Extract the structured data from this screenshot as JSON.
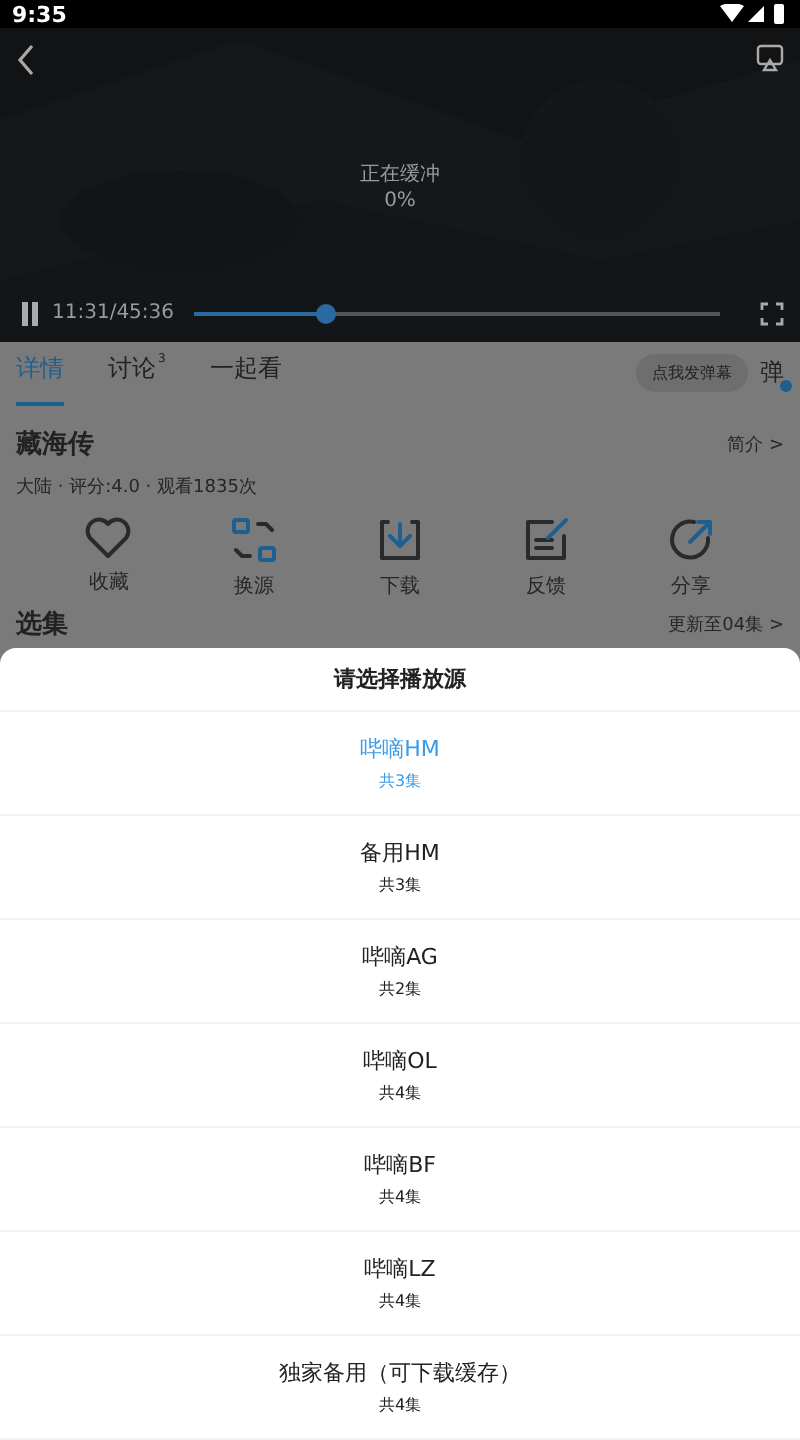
{
  "status_bar": {
    "time": "9:35"
  },
  "player": {
    "buffering": "正在缓冲",
    "percent": "0%",
    "time": "11:31/45:36",
    "level": 0.25,
    "playing": true
  },
  "tabs": [
    {
      "label": "详情",
      "selected": true
    },
    {
      "label": "讨论",
      "badge": "3",
      "selected": false
    },
    {
      "label": "一起看",
      "selected": false
    }
  ],
  "danmaku": {
    "button": "点我发弹幕",
    "toggle": "弹",
    "on": true
  },
  "show": {
    "title": "藏海传",
    "intro_link": "简介 >",
    "meta": "大陆 · 评分:4.0 · 观看1835次"
  },
  "actions": [
    {
      "kind": "heart",
      "label": "收藏"
    },
    {
      "kind": "swap",
      "label": "换源"
    },
    {
      "kind": "download",
      "label": "下载"
    },
    {
      "kind": "feedback",
      "label": "反馈"
    },
    {
      "kind": "share",
      "label": "分享"
    }
  ],
  "episodes": {
    "title": "选集",
    "update": "更新至04集 >"
  },
  "sheet": {
    "title": "请选择播放源",
    "sources": [
      {
        "name": "哔嘀HM",
        "count": "共3集",
        "selected": true
      },
      {
        "name": "备用HM",
        "count": "共3集",
        "selected": false
      },
      {
        "name": "哔嘀AG",
        "count": "共2集",
        "selected": false
      },
      {
        "name": "哔嘀OL",
        "count": "共4集",
        "selected": false
      },
      {
        "name": "哔嘀BF",
        "count": "共4集",
        "selected": false
      },
      {
        "name": "哔嘀LZ",
        "count": "共4集",
        "selected": false
      },
      {
        "name": "独家备用（可下载缓存）",
        "count": "共4集",
        "selected": false
      }
    ]
  }
}
